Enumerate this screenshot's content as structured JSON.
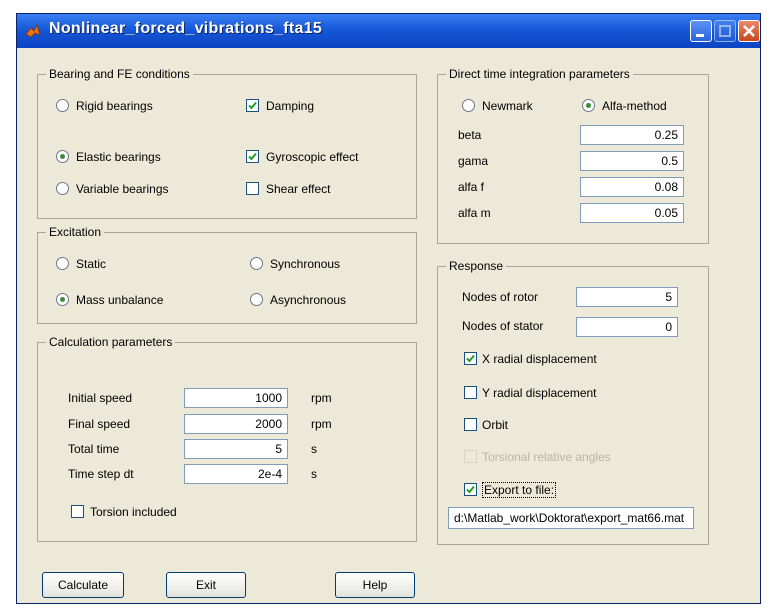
{
  "window": {
    "title": "Nonlinear_forced_vibrations_fta15"
  },
  "bearing": {
    "title": "Bearing and FE conditions",
    "rigid": "Rigid bearings",
    "elastic": "Elastic bearings",
    "variable": "Variable bearings",
    "damping": "Damping",
    "gyroscopic": "Gyroscopic effect",
    "shear": "Shear effect",
    "selected": "Elastic bearings"
  },
  "excitation": {
    "title": "Excitation",
    "static": "Static",
    "mass_unbalance": "Mass unbalance",
    "synchronous": "Synchronous",
    "asynchronous": "Asynchronous",
    "selected": "Mass unbalance"
  },
  "calc": {
    "title": "Calculation parameters",
    "initial_speed_label": "Initial speed",
    "initial_speed_value": "1000",
    "initial_speed_unit": "rpm",
    "final_speed_label": "Final speed",
    "final_speed_value": "2000",
    "final_speed_unit": "rpm",
    "total_time_label": "Total time",
    "total_time_value": "5",
    "total_time_unit": "s",
    "time_step_label": "Time step  dt",
    "time_step_value": "2e-4",
    "time_step_unit": "s",
    "torsion_label": "Torsion included"
  },
  "integration": {
    "title": "Direct time integration parameters",
    "newmark": "Newmark",
    "alfa_method": "Alfa-method",
    "selected": "Alfa-method",
    "beta_label": "beta",
    "beta_value": "0.25",
    "gama_label": "gama",
    "gama_value": "0.5",
    "alfa_f_label": "alfa f",
    "alfa_f_value": "0.08",
    "alfa_m_label": "alfa m",
    "alfa_m_value": "0.05"
  },
  "response": {
    "title": "Response",
    "nodes_rotor_label": "Nodes of rotor",
    "nodes_rotor_value": "5",
    "nodes_stator_label": "Nodes of stator",
    "nodes_stator_value": "0",
    "x_radial": "X radial displacement",
    "y_radial": "Y radial displacement",
    "orbit": "Orbit",
    "torsional": "Torsional relative angles",
    "export": "Export to file:",
    "export_path": "d:\\Matlab_work\\Doktorat\\export_mat66.mat"
  },
  "buttons": {
    "calculate": "Calculate",
    "exit": "Exit",
    "help": "Help"
  },
  "colors": {
    "titlebar": "#1658d8",
    "dialog_bg": "#ece9d8",
    "check_green": "#21a121",
    "radio_dot": "#3a8c3a"
  }
}
